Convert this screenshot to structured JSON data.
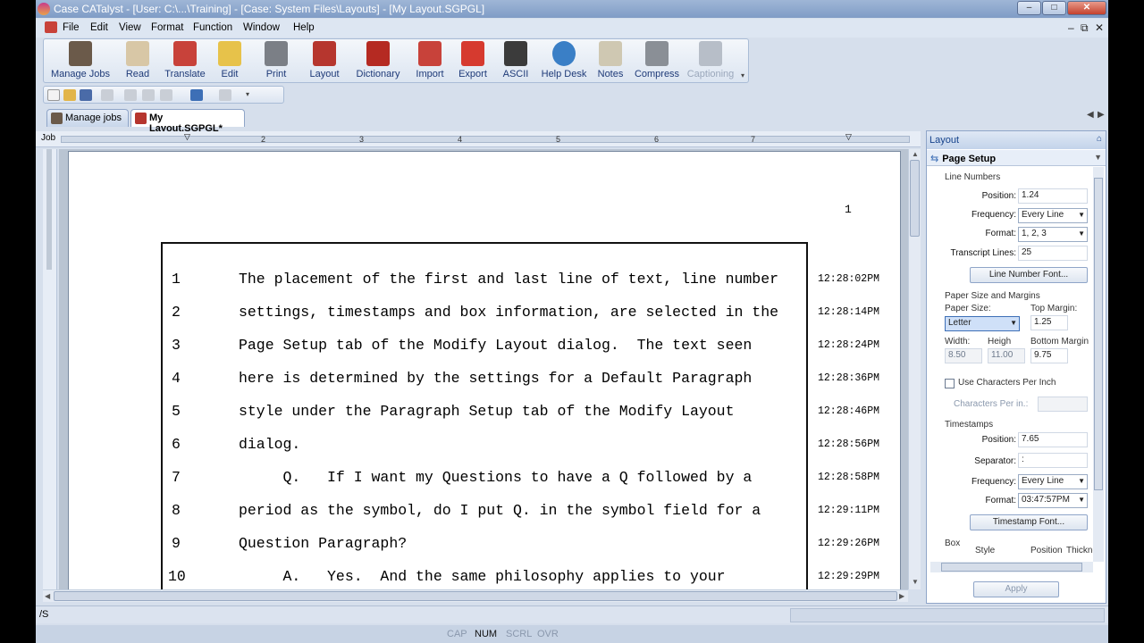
{
  "title_bar": {
    "title": "Case CATalyst - [User: C:\\...\\Training] - [Case: System Files\\Layouts] - [My Layout.SGPGL]"
  },
  "menu": {
    "items": [
      "File",
      "Edit",
      "View",
      "Format",
      "Function",
      "Window",
      "Help"
    ]
  },
  "toolbar": {
    "buttons": [
      {
        "label": "Manage Jobs",
        "icon": "manage-jobs-icon"
      },
      {
        "label": "Read",
        "icon": "read-icon"
      },
      {
        "label": "Translate",
        "icon": "translate-icon"
      },
      {
        "label": "Edit",
        "icon": "edit-icon"
      },
      {
        "label": "Print",
        "icon": "print-icon"
      },
      {
        "label": "Layout",
        "icon": "layout-icon"
      },
      {
        "label": "Dictionary",
        "icon": "dictionary-icon"
      },
      {
        "label": "Import",
        "icon": "import-icon"
      },
      {
        "label": "Export",
        "icon": "export-icon"
      },
      {
        "label": "ASCII",
        "icon": "ascii-icon"
      },
      {
        "label": "Help Desk",
        "icon": "help-desk-icon"
      },
      {
        "label": "Notes",
        "icon": "notes-icon"
      },
      {
        "label": "Compress",
        "icon": "compress-icon"
      },
      {
        "label": "Captioning",
        "icon": "captioning-icon",
        "disabled": true
      }
    ]
  },
  "tabs": [
    {
      "label": "Manage jobs",
      "active": false
    },
    {
      "label": "My Layout.SGPGL*",
      "active": true
    }
  ],
  "ruler": {
    "label": "Job",
    "ticks": [
      "1",
      "2",
      "3",
      "4",
      "5",
      "6",
      "7"
    ]
  },
  "document": {
    "page_number": "1",
    "lines": [
      {
        "num": "1",
        "text": "The placement of the first and last line of text, line number",
        "ts": "12:28:02PM"
      },
      {
        "num": "2",
        "text": "settings, timestamps and box information, are selected in the",
        "ts": "12:28:14PM"
      },
      {
        "num": "3",
        "text": "Page Setup tab of the Modify Layout dialog.  The text seen",
        "ts": "12:28:24PM"
      },
      {
        "num": "4",
        "text": "here is determined by the settings for a Default Paragraph",
        "ts": "12:28:36PM"
      },
      {
        "num": "5",
        "text": "style under the Paragraph Setup tab of the Modify Layout",
        "ts": "12:28:46PM"
      },
      {
        "num": "6",
        "text": "dialog.",
        "ts": "12:28:56PM"
      },
      {
        "num": "7",
        "text": "     Q.   If I want my Questions to have a Q followed by a",
        "ts": "12:28:58PM"
      },
      {
        "num": "8",
        "text": "period as the symbol, do I put Q. in the symbol field for a",
        "ts": "12:29:11PM"
      },
      {
        "num": "9",
        "text": "Question Paragraph?",
        "ts": "12:29:26PM"
      },
      {
        "num": "10",
        "text": "     A.   Yes.  And the same philosophy applies to your",
        "ts": "12:29:29PM"
      }
    ]
  },
  "panel": {
    "header": "Layout",
    "subheader": "Page Setup",
    "line_numbers": {
      "section": "Line Numbers",
      "position_label": "Position:",
      "position": "1.24",
      "frequency_label": "Frequency:",
      "frequency": "Every Line",
      "format_label": "Format:",
      "format": "1, 2, 3",
      "transcript_lines_label": "Transcript Lines:",
      "transcript_lines": "25",
      "font_button": "Line Number Font..."
    },
    "paper": {
      "section": "Paper Size and Margins",
      "paper_size_label": "Paper Size:",
      "paper_size": "Letter",
      "top_margin_label": "Top Margin:",
      "top_margin": "1.25",
      "width_label": "Width:",
      "width": "8.50",
      "height_label": "Heigh",
      "height": "11.00",
      "bottom_margin_label": "Bottom Margin",
      "bottom_margin": "9.75",
      "cpi_label": "Use Characters Per Inch",
      "cpi_field_label": "Characters Per in.:"
    },
    "timestamps": {
      "section": "Timestamps",
      "position_label": "Position:",
      "position": "7.65",
      "separator_label": "Separator:",
      "separator": ":",
      "frequency_label": "Frequency:",
      "frequency": "Every Line",
      "format_label": "Format:",
      "format": "03:47:57PM",
      "font_button": "Timestamp Font..."
    },
    "box": {
      "section": "Box",
      "style_label": "Style",
      "position_label": "Position",
      "thickness_label": "Thickne"
    },
    "apply_button": "Apply"
  },
  "status": {
    "command": "/S",
    "indicators": [
      {
        "label": "CAP",
        "on": false
      },
      {
        "label": "NUM",
        "on": true
      },
      {
        "label": "SCRL",
        "on": false
      },
      {
        "label": "OVR",
        "on": false
      }
    ]
  },
  "colors": {
    "title_gradient": "#7f9cc6",
    "window_bg": "#d6dfec",
    "accent": "#15428b"
  }
}
